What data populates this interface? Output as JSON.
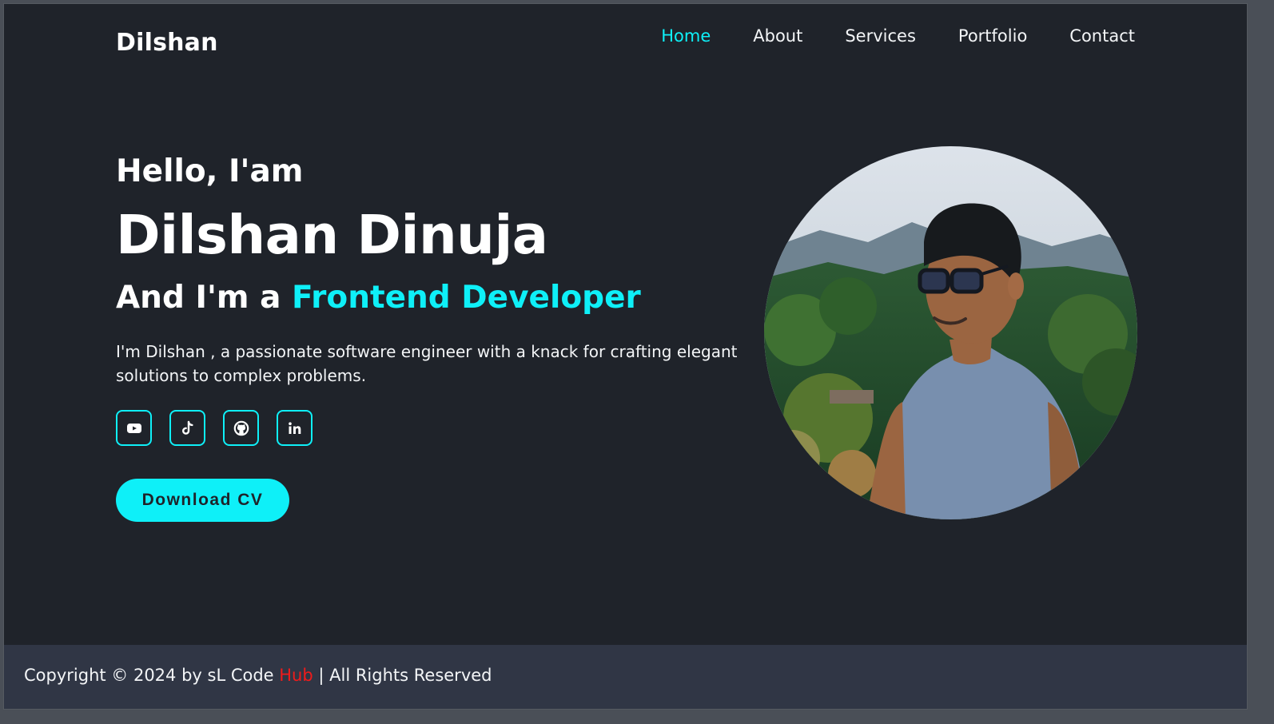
{
  "header": {
    "logo": "Dilshan",
    "nav": [
      {
        "label": "Home",
        "active": true
      },
      {
        "label": "About",
        "active": false
      },
      {
        "label": "Services",
        "active": false
      },
      {
        "label": "Portfolio",
        "active": false
      },
      {
        "label": "Contact",
        "active": false
      }
    ]
  },
  "hero": {
    "greeting": "Hello, I'am",
    "name": "Dilshan Dinuja",
    "role_prefix": "And I'm a ",
    "role_highlight": "Frontend Developer",
    "description": "I'm Dilshan , a passionate software engineer with a knack for crafting elegant solutions to complex problems.",
    "download_label": "Download CV"
  },
  "social_links": [
    {
      "icon": "youtube-icon"
    },
    {
      "icon": "tiktok-icon"
    },
    {
      "icon": "github-icon"
    },
    {
      "icon": "linkedin-icon"
    }
  ],
  "footer": {
    "copyright_prefix": "Copyright © 2024 by sL Code ",
    "copyright_highlight": "Hub",
    "copyright_suffix": " | All Rights Reserved"
  },
  "colors": {
    "accent": "#0ef0f8",
    "background": "#1f232a",
    "footer_bg": "#303645",
    "footer_highlight": "#ef1b1b"
  }
}
